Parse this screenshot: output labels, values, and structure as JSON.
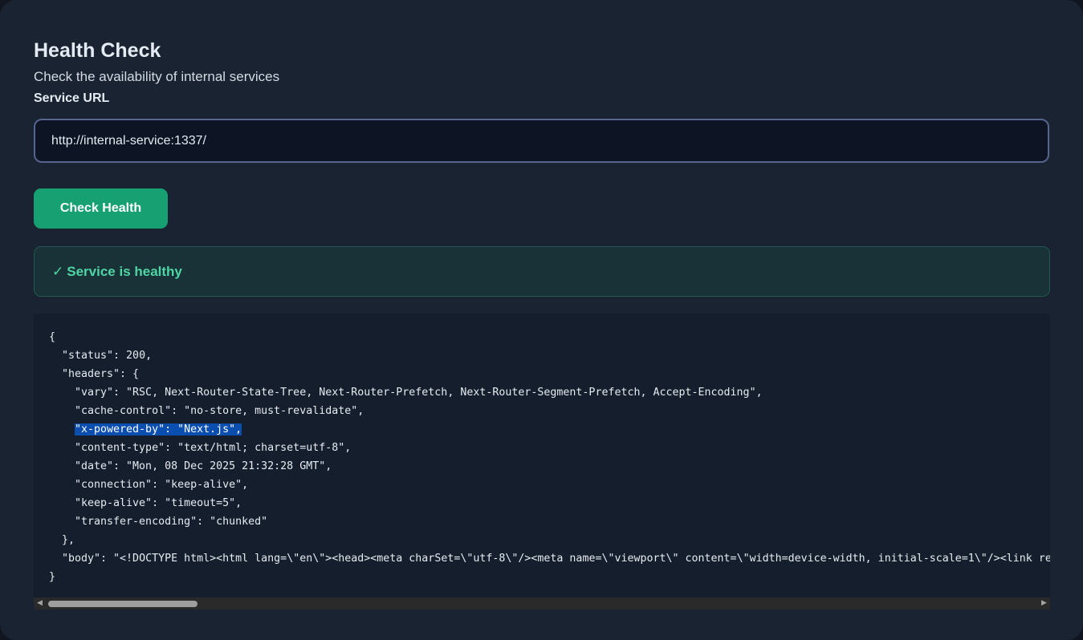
{
  "page": {
    "title": "Health Check",
    "subtitle": "Check the availability of internal services"
  },
  "form": {
    "url_label": "Service URL",
    "url_value": "http://internal-service:1337/",
    "check_button_label": "Check Health"
  },
  "status": {
    "icon": "checkmark-icon",
    "check_glyph": "✓",
    "message": "Service is healthy",
    "color": "#4fd6a4"
  },
  "response": {
    "open_brace": "{",
    "status_line": "\"status\": 200,",
    "headers_open": "\"headers\": {",
    "header_lines": [
      "\"vary\": \"RSC, Next-Router-State-Tree, Next-Router-Prefetch, Next-Router-Segment-Prefetch, Accept-Encoding\",",
      "\"cache-control\": \"no-store, must-revalidate\",",
      "\"x-powered-by\": \"Next.js\",",
      "\"content-type\": \"text/html; charset=utf-8\",",
      "\"date\": \"Mon, 08 Dec 2025 21:32:28 GMT\",",
      "\"connection\": \"keep-alive\",",
      "\"keep-alive\": \"timeout=5\",",
      "\"transfer-encoding\": \"chunked\""
    ],
    "headers_close": "},",
    "body_line": "\"body\": \"<!DOCTYPE html><html lang=\\\"en\\\"><head><meta charSet=\\\"utf-8\\\"/><meta name=\\\"viewport\\\" content=\\\"width=device-width, initial-scale=1\\\"/><link rel=\\",
    "close_brace": "}"
  },
  "scrollbar": {
    "left_arrow": "◀",
    "right_arrow": "▶"
  },
  "colors": {
    "accent_green": "#17a072",
    "selection_blue": "#0a4fb0",
    "panel_background": "#1a2332"
  }
}
